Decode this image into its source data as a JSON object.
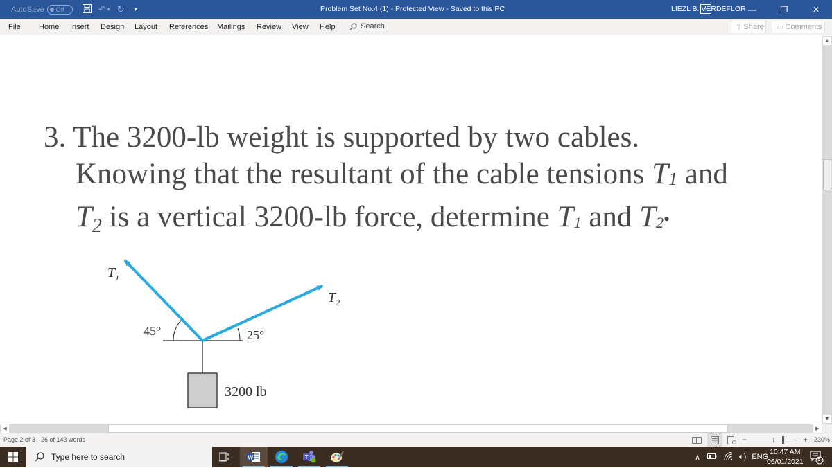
{
  "titlebar": {
    "autosave_label": "AutoSave",
    "autosave_state": "Off",
    "doc_title": "Problem Set No.4 (1)  -  Protected View  -  Saved to this PC",
    "user_name": "LIEZL B. VERDEFLOR",
    "icons": [
      "save-icon",
      "undo-icon",
      "redo-icon",
      "customize-qat-icon",
      "ribbon-display-icon",
      "minimize-icon",
      "restore-icon",
      "close-icon"
    ]
  },
  "menu": {
    "items": [
      "File",
      "Home",
      "Insert",
      "Design",
      "Layout",
      "References",
      "Mailings",
      "Review",
      "View",
      "Help"
    ],
    "search_label": "Search",
    "share_label": "Share",
    "comments_label": "Comments"
  },
  "document": {
    "problem_number": "3.",
    "line1": "The 3200-lb weight is supported by two cables.",
    "line2_a": "Knowing that the resultant of the cable tensions ",
    "line2_T": "T",
    "line2_sub": "1",
    "line2_b": " and",
    "line3_T": "T",
    "line3_sub": "2",
    "line3_a": " is a vertical 3200-lb force, determine ",
    "line3_T1": "T",
    "line3_T1_sub": "1",
    "line3_and": " and ",
    "line3_T2": "T",
    "line3_T2_sub": "2",
    "line3_end": "•",
    "figure": {
      "cable1_label": "T",
      "cable1_sub": "1",
      "cable2_label": "T",
      "cable2_sub": "2",
      "angle1_label": "45°",
      "angle2_label": "25°",
      "weight_label": "3200 lb",
      "cable_color": "#29a9e0",
      "angle1_deg": 45,
      "angle2_deg": 25
    }
  },
  "status": {
    "page": "Page 2 of 3",
    "words": "26 of 143 words",
    "zoom": "230%"
  },
  "taskbar": {
    "search_placeholder": "Type here to search",
    "apps": [
      "task-view",
      "word",
      "edge",
      "teams",
      "paint"
    ],
    "language": "ENG",
    "time": "10:47 AM",
    "date": "06/01/2021",
    "notifications": "5"
  }
}
